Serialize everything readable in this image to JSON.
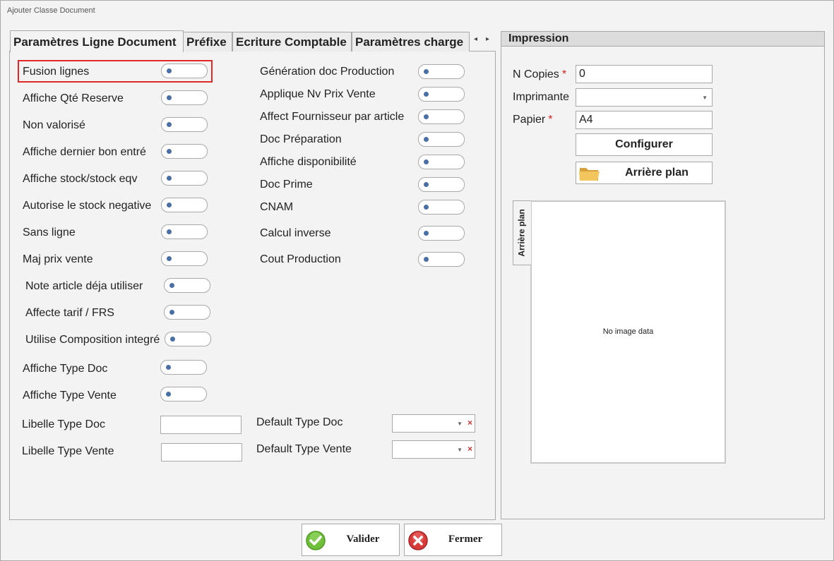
{
  "window": {
    "title": "Ajouter Classe Document"
  },
  "tabs": [
    {
      "label": "Paramètres Ligne Document",
      "active": true
    },
    {
      "label": "Préfixe",
      "active": false
    },
    {
      "label": "Ecriture Comptable",
      "active": false
    },
    {
      "label": "Paramètres charge",
      "active": false
    }
  ],
  "tab_scroll": {
    "left": "◂",
    "right": "▸"
  },
  "left_toggles": [
    {
      "label": "Fusion lignes",
      "on": false
    },
    {
      "label": "Affiche Qté Reserve",
      "on": false
    },
    {
      "label": "Non valorisé",
      "on": false
    },
    {
      "label": "Affiche dernier bon entré",
      "on": false
    },
    {
      "label": "Affiche stock/stock eqv",
      "on": false
    },
    {
      "label": "Autorise le stock negative",
      "on": false
    },
    {
      "label": "Sans ligne",
      "on": false
    },
    {
      "label": "Maj prix vente",
      "on": false
    },
    {
      "label": "Note article déja utiliser",
      "on": false
    },
    {
      "label": "Affecte tarif / FRS",
      "on": false
    },
    {
      "label": "Utilise Composition integré",
      "on": false
    },
    {
      "label": "Affiche Type Doc",
      "on": false
    },
    {
      "label": "Affiche Type Vente",
      "on": false
    }
  ],
  "right_toggles": [
    {
      "label": "Génération doc Production",
      "on": false
    },
    {
      "label": "Applique Nv Prix Vente",
      "on": false
    },
    {
      "label": "Affect Fournisseur par article",
      "on": false
    },
    {
      "label": "Doc Préparation",
      "on": false
    },
    {
      "label": "Affiche disponibilité",
      "on": false
    },
    {
      "label": "Doc Prime",
      "on": false
    },
    {
      "label": "CNAM",
      "on": false
    },
    {
      "label": "Calcul inverse",
      "on": false
    },
    {
      "label": "Cout Production",
      "on": false
    }
  ],
  "fields": {
    "libelle_type_doc": {
      "label": "Libelle Type Doc",
      "value": ""
    },
    "libelle_type_vente": {
      "label": "Libelle Type Vente",
      "value": ""
    },
    "default_type_doc": {
      "label": "Default Type Doc",
      "value": ""
    },
    "default_type_vente": {
      "label": "Default Type Vente",
      "value": ""
    }
  },
  "impression": {
    "title": "Impression",
    "n_copies": {
      "label": "N Copies",
      "value": "0",
      "required_mark": "*"
    },
    "imprimante": {
      "label": "Imprimante",
      "value": ""
    },
    "papier": {
      "label": "Papier",
      "value": "A4",
      "required_mark": "*"
    },
    "configurer_label": "Configurer",
    "arriere_plan_label": "Arrière plan",
    "side_tab_label": "Arrière plan",
    "no_image_text": "No image data"
  },
  "actions": {
    "valider_label": "Valider",
    "fermer_label": "Fermer"
  },
  "colors": {
    "highlight": "#e02a2a",
    "toggle_dot": "#4a6fa5",
    "valider_icon": "#6fbf3a",
    "fermer_icon": "#d83a3a",
    "folder_icon": "#e8b64a"
  }
}
